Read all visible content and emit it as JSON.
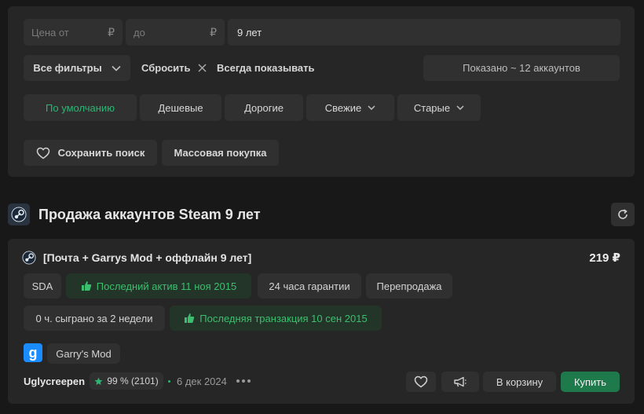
{
  "filters": {
    "price_from_placeholder": "Цена от",
    "price_to_placeholder": "до",
    "currency": "₽",
    "age_value": "9 лет",
    "all_filters": "Все фильтры",
    "reset": "Сбросить",
    "always_show": "Всегда показывать",
    "shown_count": "Показано ~ 12 аккаунтов",
    "sort": {
      "default": "По умолчанию",
      "cheap": "Дешевые",
      "expensive": "Дорогие",
      "fresh": "Свежие",
      "old": "Старые"
    },
    "save_search": "Сохранить поиск",
    "bulk_buy": "Массовая покупка"
  },
  "section": {
    "title": "Продажа аккаунтов Steam 9 лет"
  },
  "listing": {
    "title": "[Почта + Garrys Mod + оффлайн 9 лет]",
    "price": "219 ₽",
    "tags": {
      "sda": "SDA",
      "last_active": "Последний актив 11 ноя 2015",
      "guarantee": "24 часа гарантии",
      "resale": "Перепродажа",
      "played": "0 ч. сыграно за 2 недели",
      "last_transaction": "Последняя транзакция 10 сен 2015"
    },
    "game": {
      "icon_letter": "g",
      "name": "Garry's Mod"
    },
    "seller": {
      "name": "Uglycreepen",
      "rating": "99 % (2101)",
      "date": "6 дек 2024"
    },
    "actions": {
      "cart": "В корзину",
      "buy": "Купить"
    }
  },
  "colors": {
    "accent_green": "#2bb673",
    "buy_button": "#1f7a4b",
    "panel": "#262626",
    "background": "#181818"
  }
}
